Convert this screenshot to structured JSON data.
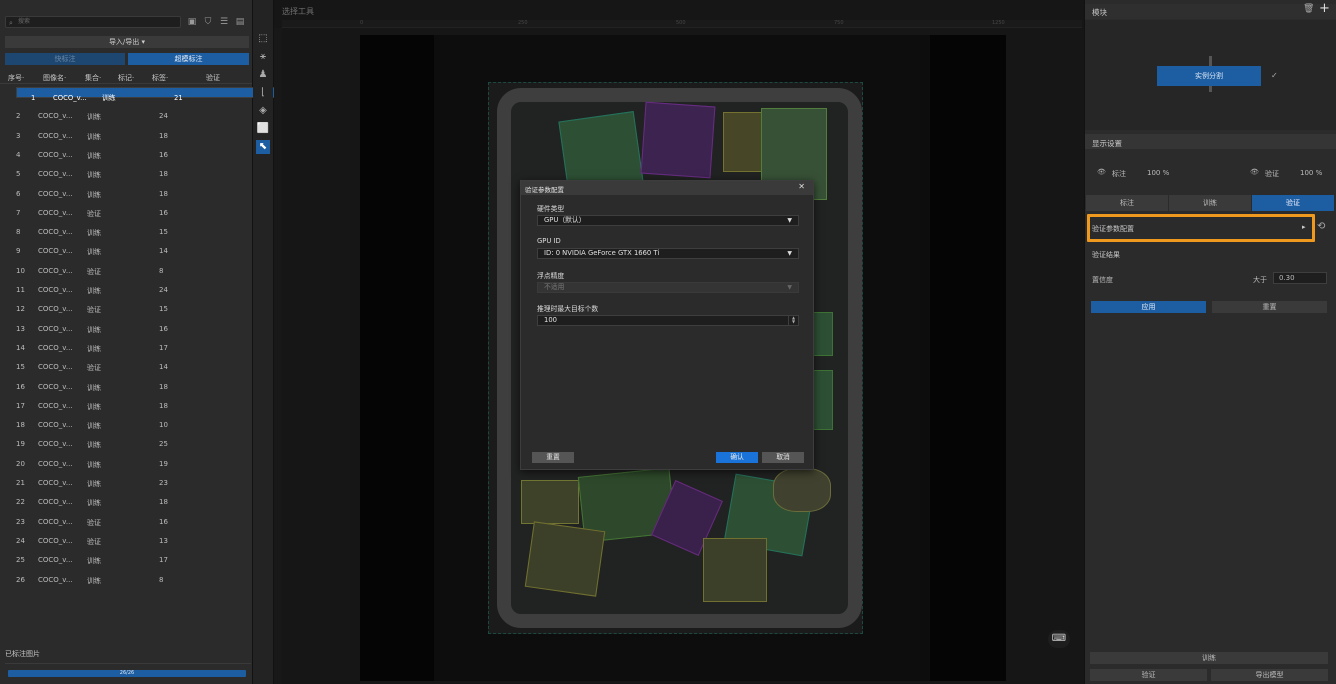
{
  "left": {
    "search_placeholder": "搜索",
    "import_export": "导入/导出 ▾",
    "mode_left": "快标注",
    "mode_right": "超模标注",
    "headers": [
      "序号·",
      "图像名·",
      "集合·",
      "标记·",
      "标签·",
      "验证"
    ],
    "rows": [
      {
        "n": "1",
        "name": "COCO_v...",
        "set": "训练",
        "label": "21"
      },
      {
        "n": "2",
        "name": "COCO_v...",
        "set": "训练",
        "label": "24"
      },
      {
        "n": "3",
        "name": "COCO_v...",
        "set": "训练",
        "label": "18"
      },
      {
        "n": "4",
        "name": "COCO_v...",
        "set": "训练",
        "label": "16"
      },
      {
        "n": "5",
        "name": "COCO_v...",
        "set": "训练",
        "label": "18"
      },
      {
        "n": "6",
        "name": "COCO_v...",
        "set": "训练",
        "label": "18"
      },
      {
        "n": "7",
        "name": "COCO_v...",
        "set": "验证",
        "label": "16"
      },
      {
        "n": "8",
        "name": "COCO_v...",
        "set": "训练",
        "label": "15"
      },
      {
        "n": "9",
        "name": "COCO_v...",
        "set": "训练",
        "label": "14"
      },
      {
        "n": "10",
        "name": "COCO_v...",
        "set": "验证",
        "label": "8"
      },
      {
        "n": "11",
        "name": "COCO_v...",
        "set": "训练",
        "label": "24"
      },
      {
        "n": "12",
        "name": "COCO_v...",
        "set": "验证",
        "label": "15"
      },
      {
        "n": "13",
        "name": "COCO_v...",
        "set": "训练",
        "label": "16"
      },
      {
        "n": "14",
        "name": "COCO_v...",
        "set": "训练",
        "label": "17"
      },
      {
        "n": "15",
        "name": "COCO_v...",
        "set": "验证",
        "label": "14"
      },
      {
        "n": "16",
        "name": "COCO_v...",
        "set": "训练",
        "label": "18"
      },
      {
        "n": "17",
        "name": "COCO_v...",
        "set": "训练",
        "label": "18"
      },
      {
        "n": "18",
        "name": "COCO_v...",
        "set": "训练",
        "label": "10"
      },
      {
        "n": "19",
        "name": "COCO_v...",
        "set": "训练",
        "label": "25"
      },
      {
        "n": "20",
        "name": "COCO_v...",
        "set": "训练",
        "label": "19"
      },
      {
        "n": "21",
        "name": "COCO_v...",
        "set": "训练",
        "label": "23"
      },
      {
        "n": "22",
        "name": "COCO_v...",
        "set": "训练",
        "label": "18"
      },
      {
        "n": "23",
        "name": "COCO_v...",
        "set": "验证",
        "label": "16"
      },
      {
        "n": "24",
        "name": "COCO_v...",
        "set": "验证",
        "label": "13"
      },
      {
        "n": "25",
        "name": "COCO_v...",
        "set": "训练",
        "label": "17"
      },
      {
        "n": "26",
        "name": "COCO_v...",
        "set": "训练",
        "label": "8"
      }
    ],
    "labeled_title": "已标注图片",
    "progress_text": "26/26",
    "progress_value": 1.0
  },
  "canvas": {
    "title": "选择工具",
    "ruler_ticks": [
      "0",
      "250",
      "500",
      "750",
      "1000",
      "1250",
      "1500"
    ]
  },
  "dialog": {
    "title": "验证参数配置",
    "hardware_label": "硬件类型",
    "hardware_value": "GPU（默认）",
    "gpu_label": "GPU ID",
    "gpu_value": "ID: 0  NVIDIA GeForce GTX 1660 Ti",
    "precision_label": "浮点精度",
    "precision_value": "不适用",
    "maxobj_label": "推理时最大目标个数",
    "maxobj_value": "100",
    "reset": "重置",
    "confirm": "确认",
    "cancel": "取消"
  },
  "right": {
    "module_title": "模块",
    "module_node": "实例分割",
    "display_title": "显示设置",
    "annotate_label": "标注",
    "annotate_pct": "100 %",
    "verify_label": "验证",
    "verify_pct": "100 %",
    "tabs": [
      "标注",
      "训练",
      "验证"
    ],
    "param_row": "验证参数配置",
    "result_title": "验证结果",
    "confidence_label": "置信度",
    "greater_than": "大于",
    "confidence_value": "0.30",
    "apply": "应用",
    "reset": "重置",
    "train": "训练",
    "verify": "验证",
    "export": "导出模型"
  },
  "colors": {
    "accent": "#1d5ea3",
    "highlight": "#ef9a1e",
    "confirm": "#1a73d9"
  }
}
